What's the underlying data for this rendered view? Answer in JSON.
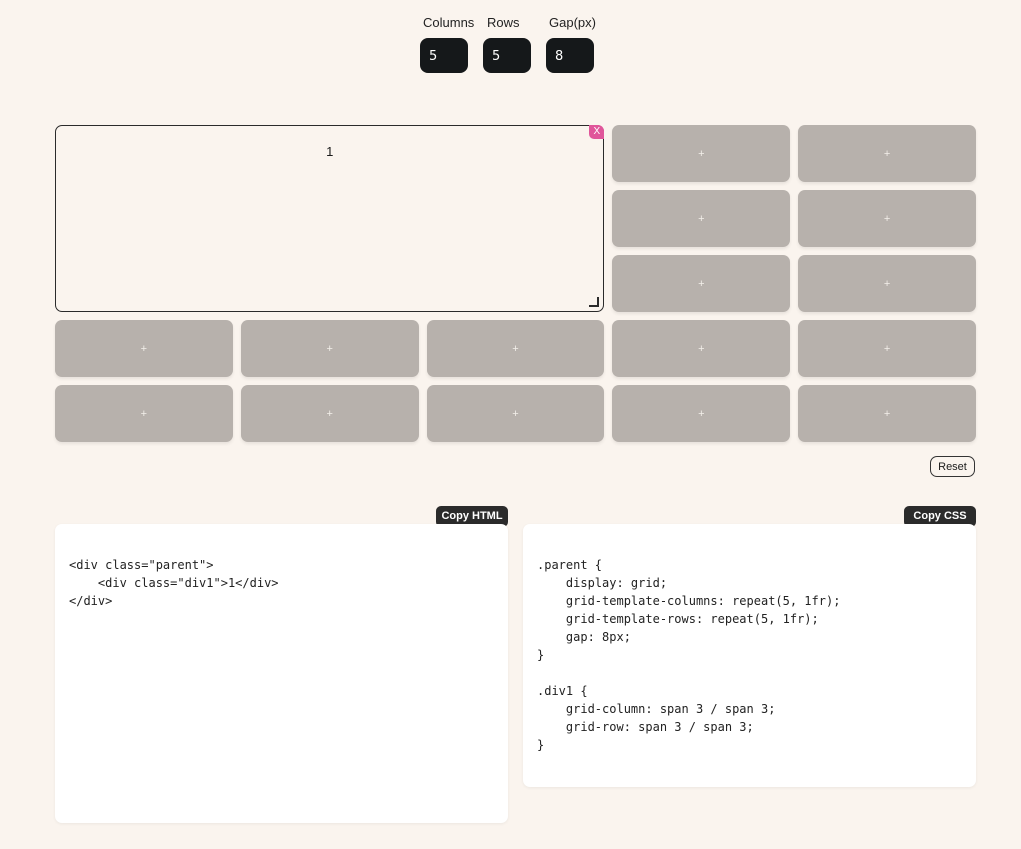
{
  "controls": {
    "columns": {
      "label": "Columns",
      "value": "5"
    },
    "rows": {
      "label": "Rows",
      "value": "5"
    },
    "gap": {
      "label": "Gap(px)",
      "value": "8"
    }
  },
  "grid": {
    "columns": 5,
    "rows": 5,
    "gap": 8,
    "cell_plus": "+",
    "item": {
      "label": "1",
      "delete_label": "X",
      "col_span": 3,
      "row_span": 3
    }
  },
  "reset_label": "Reset",
  "html_panel": {
    "copy_label": "Copy HTML",
    "code": "<div class=\"parent\">\n    <div class=\"div1\">1</div>\n</div>"
  },
  "css_panel": {
    "copy_label": "Copy CSS",
    "code": ".parent {\n    display: grid;\n    grid-template-columns: repeat(5, 1fr);\n    grid-template-rows: repeat(5, 1fr);\n    gap: 8px;\n}\n\n.div1 {\n    grid-column: span 3 / span 3;\n    grid-row: span 3 / span 3;\n}"
  },
  "colors": {
    "background": "#faf4ee",
    "cell": "#b7b1ac",
    "input": "#15181a",
    "delete": "#e0569a",
    "button": "#2b2b2b"
  }
}
